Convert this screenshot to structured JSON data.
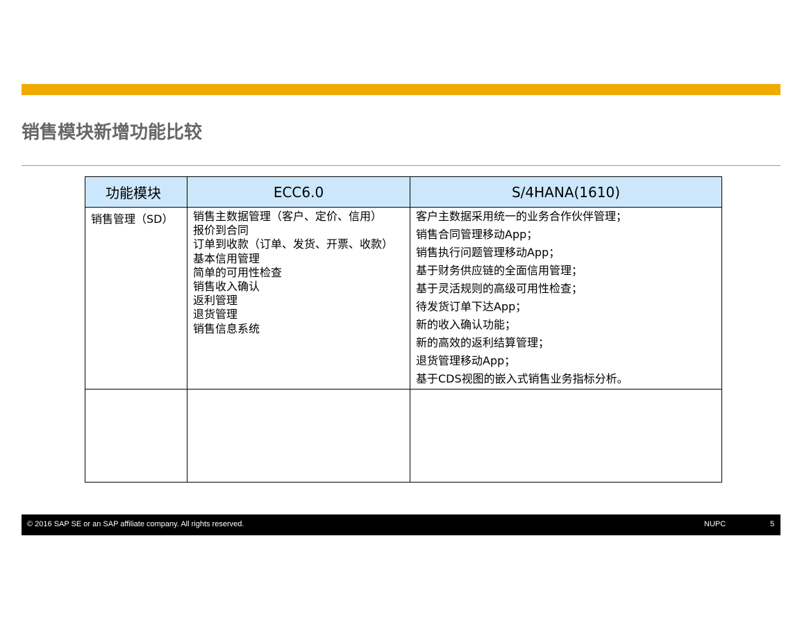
{
  "slide": {
    "title": "销售模块新增功能比较",
    "accent_color": "#f0ab00"
  },
  "table": {
    "headers": [
      "功能模块",
      "ECC6.0",
      "S/4HANA(1610)"
    ],
    "header_bg": "#cce7fb",
    "rows": [
      {
        "module": "销售管理（SD）",
        "ecc": [
          "销售主数据管理（客户、定价、信用）",
          "报价到合同",
          "订单到收款（订单、发货、开票、收款）",
          "基本信用管理",
          "简单的可用性检查",
          "销售收入确认",
          "返利管理",
          "退货管理",
          "销售信息系统"
        ],
        "s4": [
          "客户主数据采用统一的业务合作伙伴管理；",
          "销售合同管理移动App；",
          "销售执行问题管理移动App；",
          "基于财务供应链的全面信用管理；",
          "基于灵活规则的高级可用性检查；",
          "待发货订单下达App；",
          "新的收入确认功能；",
          "新的高效的返利结算管理；",
          "退货管理移动App；",
          "基于CDS视图的嵌入式销售业务指标分析。"
        ]
      },
      {
        "module": "",
        "ecc": [],
        "s4": []
      }
    ]
  },
  "footer": {
    "copyright": "©  2016 SAP SE or an SAP affiliate company. All rights reserved.",
    "org": "NUPC",
    "page": "5"
  }
}
